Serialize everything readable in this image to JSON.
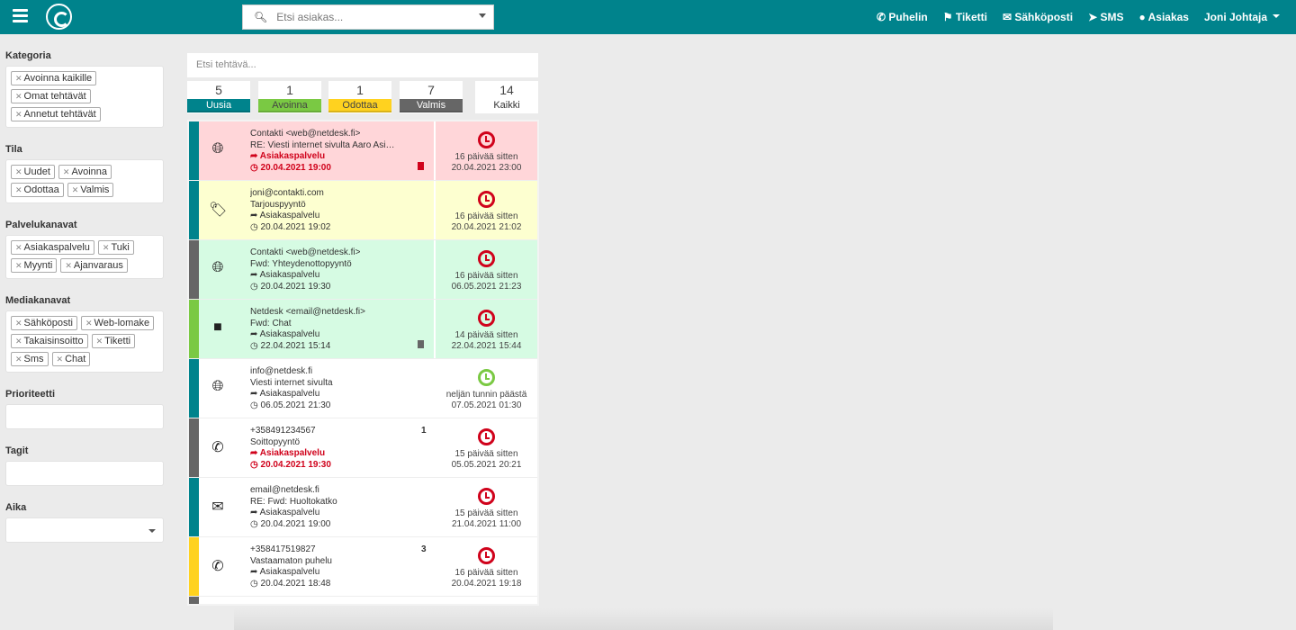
{
  "header": {
    "search_placeholder": "Etsi asiakas...",
    "nav": [
      "Puhelin",
      "Tiketti",
      "Sähköposti",
      "SMS",
      "Asiakas"
    ],
    "user": "Joni Johtaja"
  },
  "sidebar": {
    "kategoria": {
      "label": "Kategoria",
      "tags": [
        "Avoinna kaikille",
        "Omat tehtävät",
        "Annetut tehtävät"
      ]
    },
    "tila": {
      "label": "Tila",
      "tags": [
        "Uudet",
        "Avoinna",
        "Odottaa",
        "Valmis"
      ]
    },
    "palvelukanavat": {
      "label": "Palvelukanavat",
      "tags": [
        "Asiakaspalvelu",
        "Tuki",
        "Myynti",
        "Ajanvaraus"
      ]
    },
    "mediakanavat": {
      "label": "Mediakanavat",
      "tags": [
        "Sähköposti",
        "Web-lomake",
        "Takaisinsoitto",
        "Tiketti",
        "Sms",
        "Chat"
      ]
    },
    "prioriteetti": {
      "label": "Prioriteetti"
    },
    "tagit": {
      "label": "Tagit"
    },
    "aika": {
      "label": "Aika"
    }
  },
  "task_search_placeholder": "Etsi tehtävä...",
  "counters": [
    {
      "count": "5",
      "label": "Uusia",
      "color": "#00838c"
    },
    {
      "count": "1",
      "label": "Avoinna",
      "color": "#7ac943"
    },
    {
      "count": "1",
      "label": "Odottaa",
      "color": "#ffd21f"
    },
    {
      "count": "7",
      "label": "Valmis",
      "color": "#666666"
    },
    {
      "count": "14",
      "label": "Kaikki",
      "color": ""
    }
  ],
  "tasks": [
    {
      "bg": "#ffd6d9",
      "stripe": "#00838c",
      "icon": "globe",
      "from": "Contakti <web@netdesk.fi>",
      "subject": "RE: Viesti internet sivulta Aaro Asiakas",
      "channel": "Asiakaspalvelu",
      "created": "20.04.2021 19:00",
      "overdue": true,
      "attachment": "red",
      "count": "",
      "clock": "red",
      "relative": "16 päivää sitten",
      "due": "20.04.2021 23:00"
    },
    {
      "bg": "#fdffd0",
      "stripe": "#00838c",
      "icon": "tag",
      "from": "joni@contakti.com",
      "subject": "Tarjouspyyntö",
      "channel": "Asiakaspalvelu",
      "created": "20.04.2021 19:02",
      "overdue": false,
      "attachment": "",
      "count": "",
      "clock": "red",
      "relative": "16 päivää sitten",
      "due": "20.04.2021 21:02"
    },
    {
      "bg": "#d6fbe3",
      "stripe": "#666666",
      "icon": "globe",
      "from": "Contakti <web@netdesk.fi>",
      "subject": "Fwd: Yhteydenottopyyntö",
      "channel": "Asiakaspalvelu",
      "created": "20.04.2021 19:30",
      "overdue": false,
      "attachment": "",
      "count": "",
      "clock": "red",
      "relative": "16 päivää sitten",
      "due": "06.05.2021 21:23"
    },
    {
      "bg": "#d6fbe3",
      "stripe": "#7ac943",
      "icon": "chat",
      "from": "Netdesk <email@netdesk.fi>",
      "subject": "Fwd: Chat",
      "channel": "Asiakaspalvelu",
      "created": "22.04.2021 15:14",
      "overdue": false,
      "attachment": "gray",
      "count": "",
      "clock": "red",
      "relative": "14 päivää sitten",
      "due": "22.04.2021 15:44"
    },
    {
      "bg": "#ffffff",
      "stripe": "#00838c",
      "icon": "globe",
      "from": "info@netdesk.fi",
      "subject": "Viesti internet sivulta",
      "channel": "Asiakaspalvelu",
      "created": "06.05.2021 21:30",
      "overdue": false,
      "attachment": "",
      "count": "",
      "clock": "green",
      "relative": "neljän tunnin päästä",
      "due": "07.05.2021 01:30"
    },
    {
      "bg": "#ffffff",
      "stripe": "#666666",
      "icon": "phone",
      "from": "+358491234567",
      "subject": "Soittopyyntö",
      "channel": "Asiakaspalvelu",
      "created": "20.04.2021 19:30",
      "overdue": true,
      "attachment": "",
      "count": "1",
      "clock": "red",
      "relative": "15 päivää sitten",
      "due": "05.05.2021 20:21"
    },
    {
      "bg": "#ffffff",
      "stripe": "#00838c",
      "icon": "envelope",
      "from": "email@netdesk.fi",
      "subject": "RE: Fwd: Huoltokatko",
      "channel": "Asiakaspalvelu",
      "created": "20.04.2021 19:00",
      "overdue": false,
      "attachment": "",
      "count": "",
      "clock": "red",
      "relative": "15 päivää sitten",
      "due": "21.04.2021 11:00"
    },
    {
      "bg": "#ffffff",
      "stripe": "#ffd21f",
      "icon": "phone",
      "from": "+358417519827",
      "subject": "Vastaamaton puhelu",
      "channel": "Asiakaspalvelu",
      "created": "20.04.2021 18:48",
      "overdue": false,
      "attachment": "",
      "count": "3",
      "clock": "red",
      "relative": "16 päivää sitten",
      "due": "20.04.2021 19:18"
    }
  ]
}
